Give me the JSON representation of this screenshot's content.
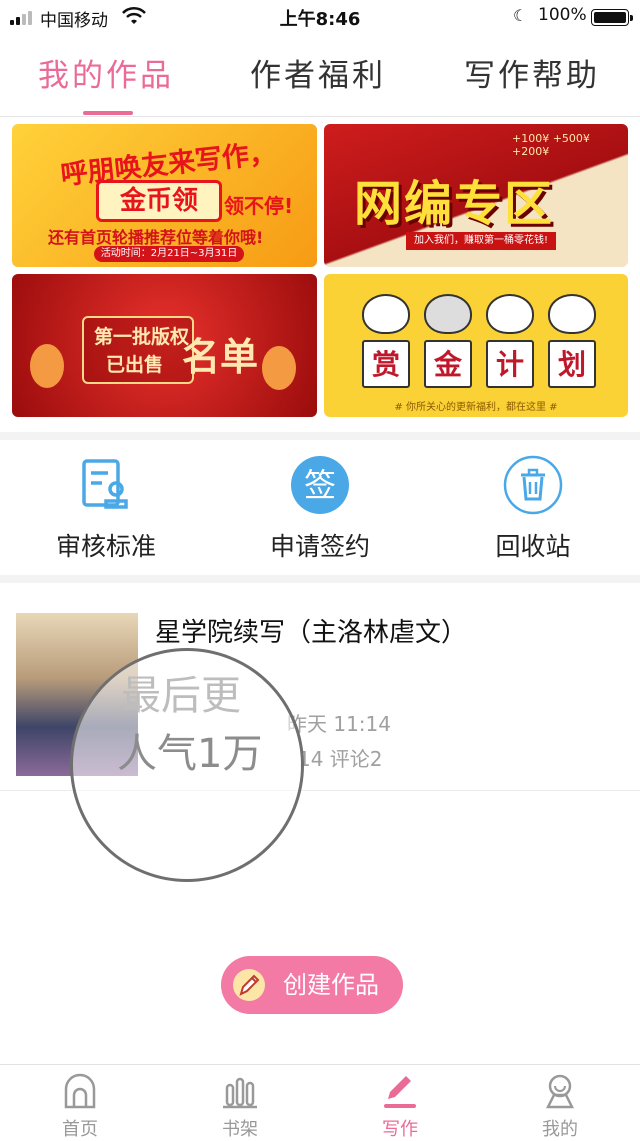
{
  "status_bar": {
    "carrier": "中国移动",
    "time": "上午8:46",
    "battery": "100%"
  },
  "tabs": [
    {
      "label": "我的作品",
      "active": true
    },
    {
      "label": "作者福利",
      "active": false
    },
    {
      "label": "写作帮助",
      "active": false
    }
  ],
  "banners": {
    "invite": {
      "line1": "呼朋唤友来写作，",
      "line2": "金币领",
      "line2b": "领不停!",
      "line3": "还有首页轮播推荐位等着你哦!",
      "line4": "活动时间：2月21日~3月31日"
    },
    "web_editor": {
      "title": "网编专区",
      "ribbon": "加入我们，赚取第一桶零花钱!",
      "prices": "+100¥  +500¥  +200¥"
    },
    "copyright": {
      "line1": "第一批版权",
      "line2": "已出售",
      "line3": "名单"
    },
    "bounty": {
      "chars": [
        "赏",
        "金",
        "计",
        "划"
      ],
      "footer": "# 你所关心的更新福利，都在这里 #"
    }
  },
  "quick_actions": [
    {
      "label": "审核标准",
      "icon": "review-standard-icon"
    },
    {
      "label": "申请签约",
      "icon": "sign-icon",
      "icon_text": "签"
    },
    {
      "label": "回收站",
      "icon": "trash-icon"
    }
  ],
  "work": {
    "title": "星学院续写（主洛林虐文）",
    "updated_partial": "昨天 11:14",
    "stats_partial": "14 评论2",
    "magnified_line1": "最后更",
    "magnified_line2": "人气1万"
  },
  "create_button": {
    "label": "创建作品"
  },
  "bottom_nav": [
    {
      "label": "首页",
      "icon": "home-icon",
      "active": false
    },
    {
      "label": "书架",
      "icon": "bookshelf-icon",
      "active": false
    },
    {
      "label": "写作",
      "icon": "pen-icon",
      "active": true
    },
    {
      "label": "我的",
      "icon": "profile-icon",
      "active": false
    }
  ],
  "colors": {
    "accent": "#ea6b97",
    "create_button": "#f37aa4",
    "icon_blue": "#4aa8e6"
  }
}
